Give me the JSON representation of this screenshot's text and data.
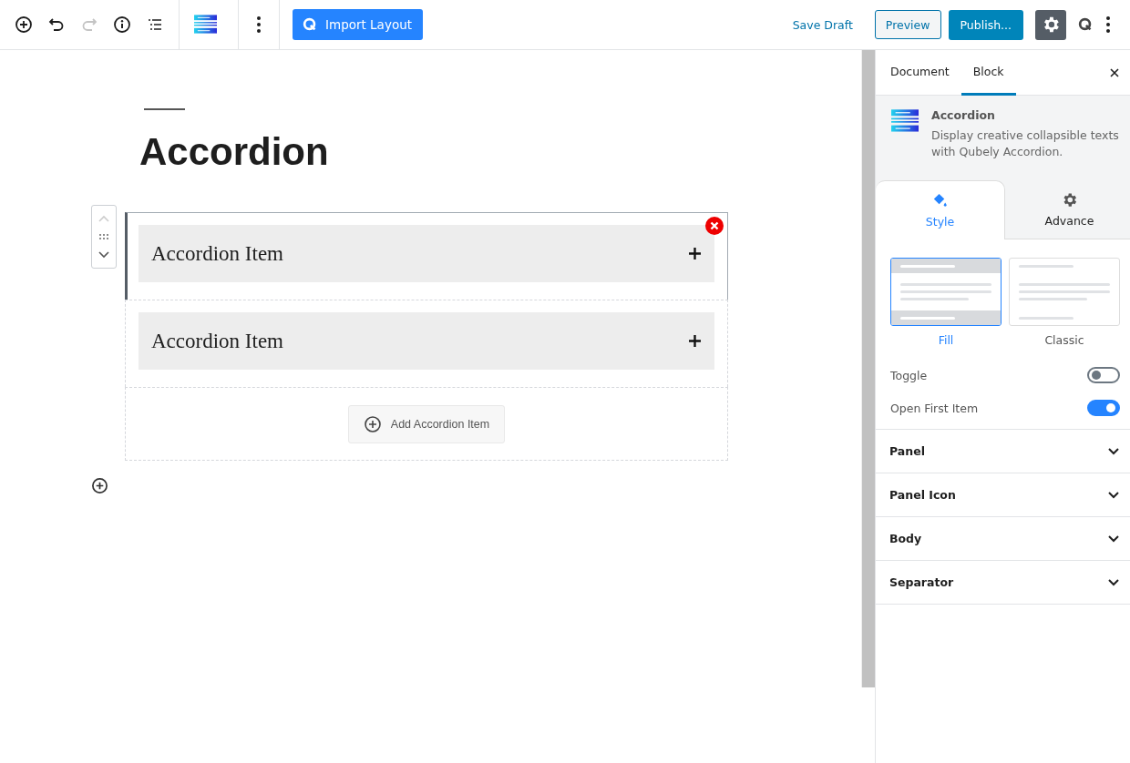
{
  "toolbar": {
    "tools": [
      {
        "kind": "add",
        "disabled": false
      },
      {
        "kind": "undo",
        "disabled": false
      },
      {
        "kind": "redo",
        "disabled": true
      },
      {
        "kind": "info",
        "disabled": false
      },
      {
        "kind": "outline",
        "disabled": false
      }
    ],
    "import_button": "Import Layout",
    "save_draft": "Save Draft",
    "preview": "Preview",
    "publish": "Publish...",
    "settings_on": true
  },
  "editor": {
    "title": "Accordion",
    "items": [
      {
        "label": "Accordion Item",
        "selected": true
      },
      {
        "label": "Accordion Item",
        "selected": false
      }
    ],
    "add_button": "Add Accordion Item"
  },
  "sidebar": {
    "tabs": [
      {
        "label": "Document",
        "selected": false
      },
      {
        "label": "Block",
        "selected": true
      }
    ],
    "block": {
      "name": "Accordion",
      "description": "Display creative collapsible texts with Qubely Accordion."
    },
    "sub_tabs": [
      {
        "kind": "style",
        "label": "Style",
        "selected": true
      },
      {
        "kind": "advance",
        "label": "Advance",
        "selected": false
      }
    ],
    "styles": [
      {
        "kind": "fill",
        "label": "Fill",
        "selected": true
      },
      {
        "kind": "classic",
        "label": "Classic",
        "selected": false
      }
    ],
    "toggles": [
      {
        "label": "Toggle",
        "on": false
      },
      {
        "label": "Open First Item",
        "on": true
      }
    ],
    "panels": [
      {
        "label": "Panel",
        "expanded": false
      },
      {
        "label": "Panel Icon",
        "expanded": false
      },
      {
        "label": "Body",
        "expanded": false
      },
      {
        "label": "Separator",
        "expanded": false
      }
    ]
  }
}
